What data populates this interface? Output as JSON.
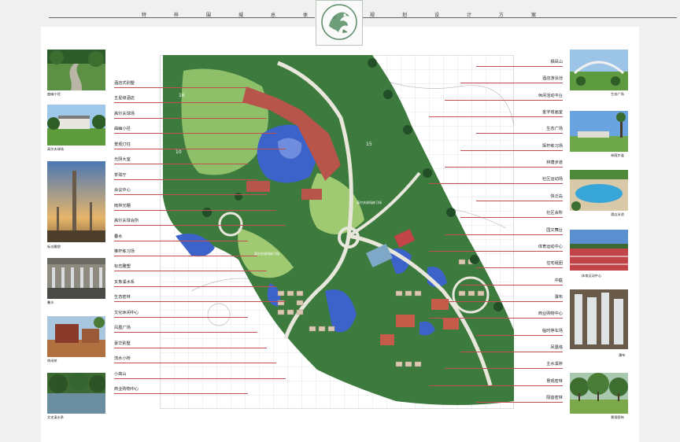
{
  "header": {
    "title_chars": [
      "特",
      "梓",
      "围",
      "城",
      "总",
      "体",
      "规",
      "划",
      "设",
      "计",
      "方",
      "案"
    ]
  },
  "left_photos": [
    {
      "caption": "曲幽小径"
    },
    {
      "caption": "高尔夫球场"
    },
    {
      "caption": "标志雕塑"
    },
    {
      "caption": "叠水"
    },
    {
      "caption": "休闲茶"
    },
    {
      "caption": "文史溪水系"
    }
  ],
  "right_photos": [
    {
      "caption": "生态广场"
    },
    {
      "caption": "林荫步道"
    },
    {
      "caption": "酒店泳池"
    },
    {
      "caption": "体育运动中心"
    },
    {
      "caption": "瀑布"
    },
    {
      "caption": "景观密林"
    }
  ],
  "left_labels": [
    "酒店式别墅",
    "五星级酒店",
    "高尔夫球场",
    "曲幽小径",
    "景观灯柱",
    "光阴大室",
    "茶球厅",
    "会议中心",
    "雨林光棚",
    "高尔夫球会所",
    "叠水",
    "推杆练习场",
    "标志雕塑",
    "叉象溪水系",
    "生态密林",
    "文化休闲中心",
    "凤凰广场",
    "豪华别墅",
    "流水小桥",
    "小高山",
    "商业购物中心"
  ],
  "right_labels": [
    "栖凤山",
    "酒店游泳池",
    "休闲活动平台",
    "金字塔画室",
    "生态广场",
    "挥杆练习场",
    "林荫步道",
    "社区运动场",
    "快泛岛",
    "社区会所",
    "园又舞台",
    "体育运动中心",
    "住宅组团",
    "中庭",
    "瀑布",
    "商业购物中心",
    "临时停车场",
    "凤凰塔",
    "主水溪桥",
    "景观密林",
    "隔音密林"
  ],
  "map": {
    "numbers": [
      "16",
      "10",
      "15"
    ],
    "zone_labels": [
      "高尔夫球场练习场",
      "高尔夫球场练习场"
    ]
  },
  "colors": {
    "page_bg": "#f0f0f0",
    "sheet_bg": "#ffffff",
    "leader": "#c05050",
    "forest": "#2f6e3a",
    "lawn": "#8bb86a",
    "water": "#3b63c9",
    "building": "#b8554a"
  }
}
